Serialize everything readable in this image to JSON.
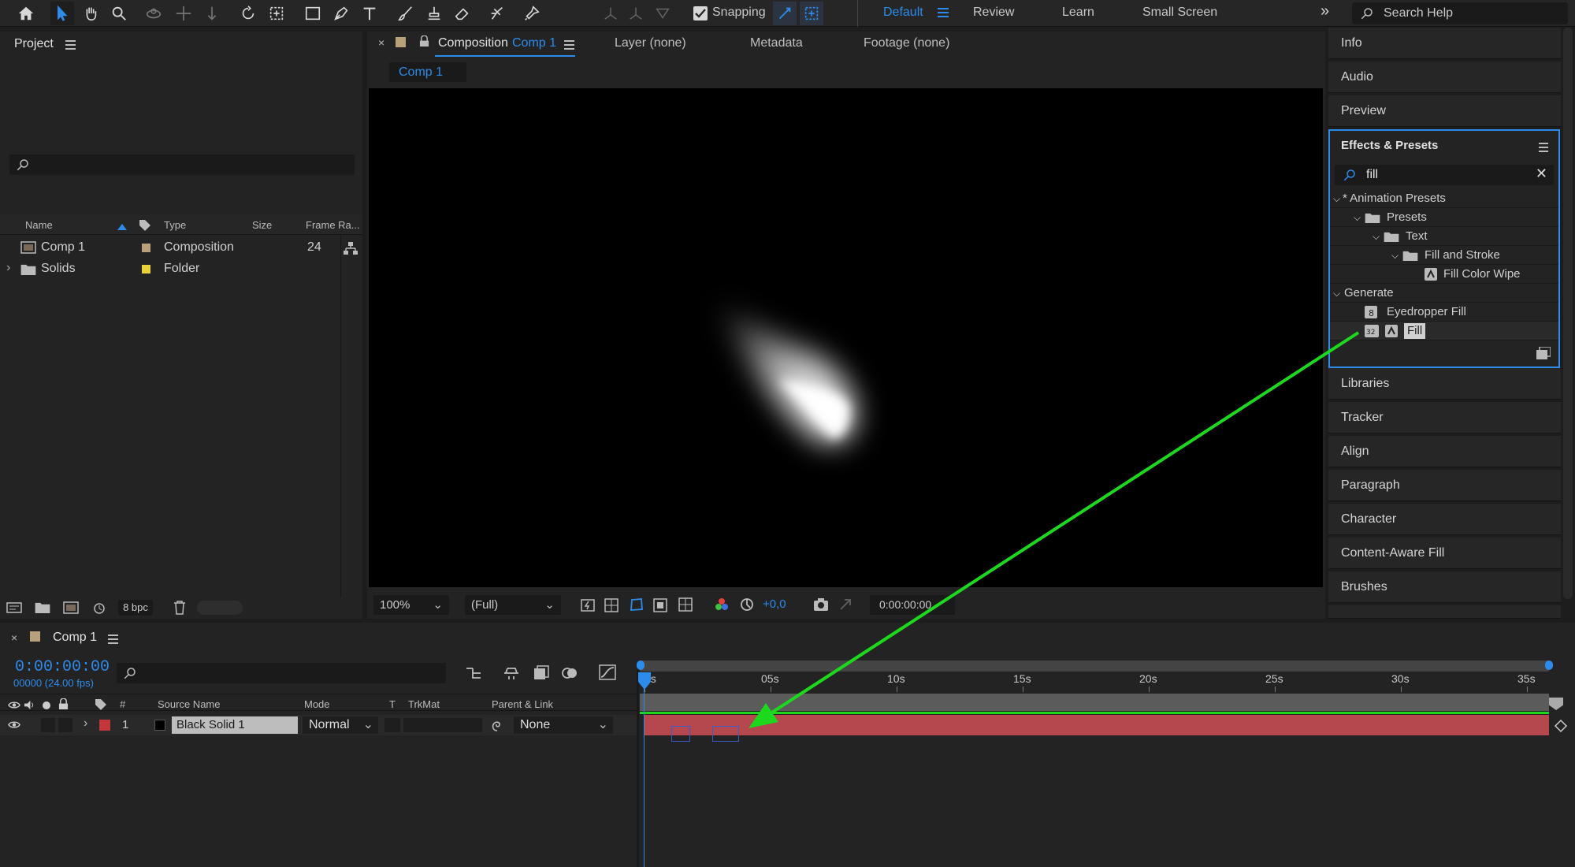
{
  "toolbar": {
    "snapping_label": "Snapping",
    "workspaces": [
      "Default",
      "Review",
      "Learn",
      "Small Screen"
    ],
    "active_workspace": "Default",
    "search_placeholder": "Search Help",
    "accent": "#2d8ceb"
  },
  "project": {
    "title": "Project",
    "columns": [
      "Name",
      "Type",
      "Size",
      "Frame Ra..."
    ],
    "items": [
      {
        "name": "Comp 1",
        "type": "Composition",
        "frame_rate": "24",
        "label_color": "#b8a07a"
      },
      {
        "name": "Solids",
        "type": "Folder",
        "frame_rate": "",
        "label_color": "#e8d23c"
      }
    ],
    "bpc": "8 bpc"
  },
  "viewer": {
    "tab_prefix": "Composition",
    "tab_comp": "Comp 1",
    "tabs": [
      "Layer (none)",
      "Metadata",
      "Footage (none)"
    ],
    "breadcrumb": "Comp 1",
    "zoom": "100%",
    "resolution": "(Full)",
    "exposure": "+0,0",
    "timecode": "0:00:00:00"
  },
  "right_panels_top": [
    "Info",
    "Audio",
    "Preview"
  ],
  "effects": {
    "title": "Effects & Presets",
    "search_value": "fill",
    "tree": [
      {
        "label": "* Animation Presets",
        "level": 0,
        "kind": "group"
      },
      {
        "label": "Presets",
        "level": 1,
        "kind": "folder"
      },
      {
        "label": "Text",
        "level": 2,
        "kind": "folder"
      },
      {
        "label": "Fill and Stroke",
        "level": 3,
        "kind": "folder"
      },
      {
        "label": "Fill Color Wipe",
        "level": 4,
        "kind": "preset"
      },
      {
        "label": "Generate",
        "level": 0,
        "kind": "group"
      },
      {
        "label": "Eyedropper Fill",
        "level": 1,
        "kind": "effect"
      },
      {
        "label": "Fill",
        "level": 1,
        "kind": "effect",
        "selected": true
      }
    ]
  },
  "right_panels_bottom": [
    "Libraries",
    "Tracker",
    "Align",
    "Paragraph",
    "Character",
    "Content-Aware Fill",
    "Brushes"
  ],
  "timeline": {
    "comp_name": "Comp 1",
    "timecode": "0:00:00:00",
    "frames": "00000 (24.00 fps)",
    "columns": [
      "#",
      "Source Name",
      "Mode",
      "T",
      "TrkMat",
      "Parent & Link"
    ],
    "ruler": [
      "0s",
      "05s",
      "10s",
      "15s",
      "20s",
      "25s",
      "30s",
      "35s"
    ],
    "layers": [
      {
        "index": "1",
        "name": "Black Solid 1",
        "mode": "Normal",
        "parent": "None",
        "label_color": "#c03838"
      }
    ]
  }
}
